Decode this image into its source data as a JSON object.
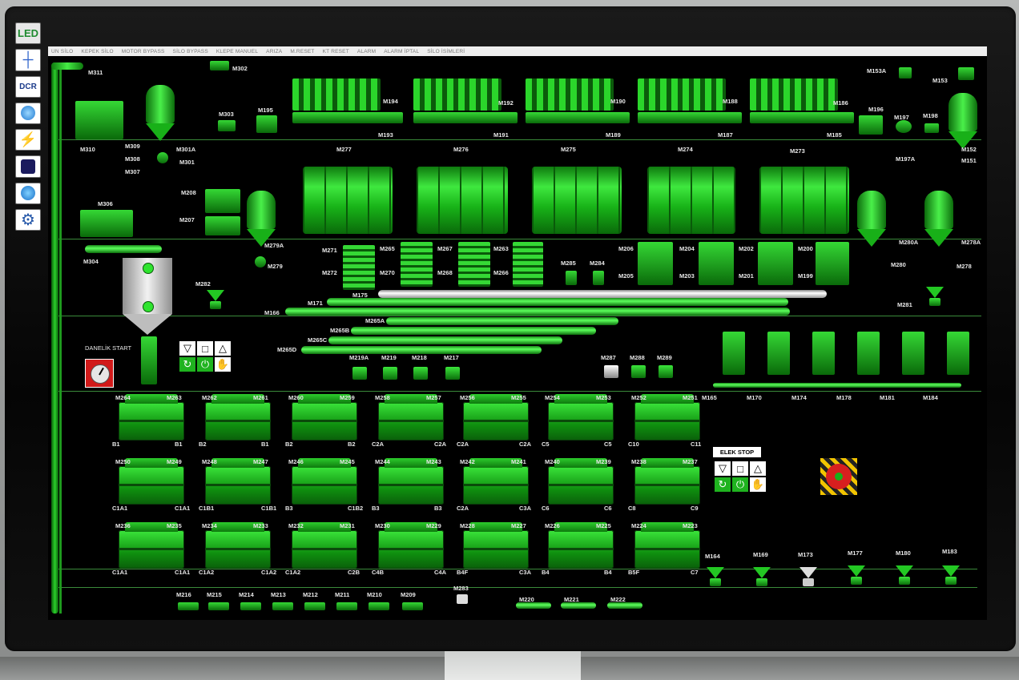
{
  "sidebar": {
    "led_label": "LED",
    "buttons": [
      "tower-icon",
      "dcr-icon",
      "globe-icon",
      "chart-icon",
      "panel-icon",
      "water-icon",
      "gear-icon"
    ]
  },
  "menu": [
    "UN SİLO",
    "KEPEK SİLO",
    "MOTOR BYPASS",
    "SİLO BYPASS",
    "KLEPE MANUEL",
    "ARIZA",
    "M.RESET",
    "KT RESET",
    "ALARM",
    "ALARM İPTAL",
    "SİLO İSİMLERİ"
  ],
  "controls": {
    "start_label": "DANELİK START",
    "stop_label": "ELEK STOP"
  },
  "labels": {
    "top": [
      "M311",
      "M302",
      "M303",
      "M195",
      "M194",
      "M193",
      "M192",
      "M191",
      "M190",
      "M189",
      "M188",
      "M187",
      "M186",
      "M185",
      "M196",
      "M197",
      "M198",
      "M153A",
      "M153",
      "M152",
      "M151",
      "M197A"
    ],
    "left": [
      "M310",
      "M309",
      "M308",
      "M307",
      "M301A",
      "M301",
      "M208",
      "M207",
      "M306",
      "M304",
      "M279A",
      "M279",
      "M282"
    ],
    "sifters": [
      "M277",
      "M276",
      "M275",
      "M274",
      "M273"
    ],
    "mid": [
      "M271",
      "M272",
      "M265",
      "M270",
      "M267",
      "M268",
      "M263",
      "M266",
      "M285",
      "M284",
      "M206",
      "M205",
      "M204",
      "M203",
      "M202",
      "M201",
      "M200",
      "M199",
      "M280A",
      "M280",
      "M278A",
      "M278",
      "M281"
    ],
    "rollers": [
      "M175",
      "M171",
      "M166",
      "M265A",
      "M265B",
      "M265C",
      "M265D"
    ],
    "small": [
      "M219A",
      "M219",
      "M218",
      "M217",
      "M287",
      "M288",
      "M289"
    ],
    "right_row": [
      "M165",
      "M170",
      "M174",
      "M178",
      "M181",
      "M184"
    ],
    "bottom": [
      "M216",
      "M215",
      "M214",
      "M213",
      "M212",
      "M211",
      "M210",
      "M209",
      "M283",
      "M220",
      "M221",
      "M222"
    ],
    "bottom_right": [
      "M164",
      "M169",
      "M173",
      "M177",
      "M180",
      "M183"
    ]
  },
  "mills": [
    {
      "l": "M264",
      "r": "M263",
      "bl": "B1",
      "br": "B1"
    },
    {
      "l": "M262",
      "r": "M261",
      "bl": "B2",
      "br": "B1"
    },
    {
      "l": "M260",
      "r": "M259",
      "bl": "B2",
      "br": "B2"
    },
    {
      "l": "M258",
      "r": "M257",
      "bl": "C2A",
      "br": "C2A"
    },
    {
      "l": "M256",
      "r": "M255",
      "bl": "C2A",
      "br": "C2A"
    },
    {
      "l": "M254",
      "r": "M253",
      "bl": "C5",
      "br": "C5"
    },
    {
      "l": "M252",
      "r": "M251",
      "bl": "C10",
      "br": "C11"
    },
    {
      "l": "M250",
      "r": "M249",
      "bl": "C1A1",
      "br": "C1A1"
    },
    {
      "l": "M248",
      "r": "M247",
      "bl": "C1B1",
      "br": "C1B1"
    },
    {
      "l": "M246",
      "r": "M245",
      "bl": "B3",
      "br": "C1B2"
    },
    {
      "l": "M244",
      "r": "M243",
      "bl": "B3",
      "br": "B3"
    },
    {
      "l": "M242",
      "r": "M241",
      "bl": "C2A",
      "br": "C3A"
    },
    {
      "l": "M240",
      "r": "M239",
      "bl": "C6",
      "br": "C6"
    },
    {
      "l": "M238",
      "r": "M237",
      "bl": "C8",
      "br": "C9"
    },
    {
      "l": "M236",
      "r": "M235",
      "bl": "C1A1",
      "br": "C1A1"
    },
    {
      "l": "M234",
      "r": "M233",
      "bl": "C1A2",
      "br": "C1A2"
    },
    {
      "l": "M232",
      "r": "M231",
      "bl": "C1A2",
      "br": "C2B"
    },
    {
      "l": "M230",
      "r": "M229",
      "bl": "C4B",
      "br": "C4A"
    },
    {
      "l": "M228",
      "r": "M227",
      "bl": "B4F",
      "br": "C3A"
    },
    {
      "l": "M226",
      "r": "M225",
      "bl": "B4",
      "br": "B4"
    },
    {
      "l": "M224",
      "r": "M223",
      "bl": "B5F",
      "br": "C7"
    }
  ]
}
